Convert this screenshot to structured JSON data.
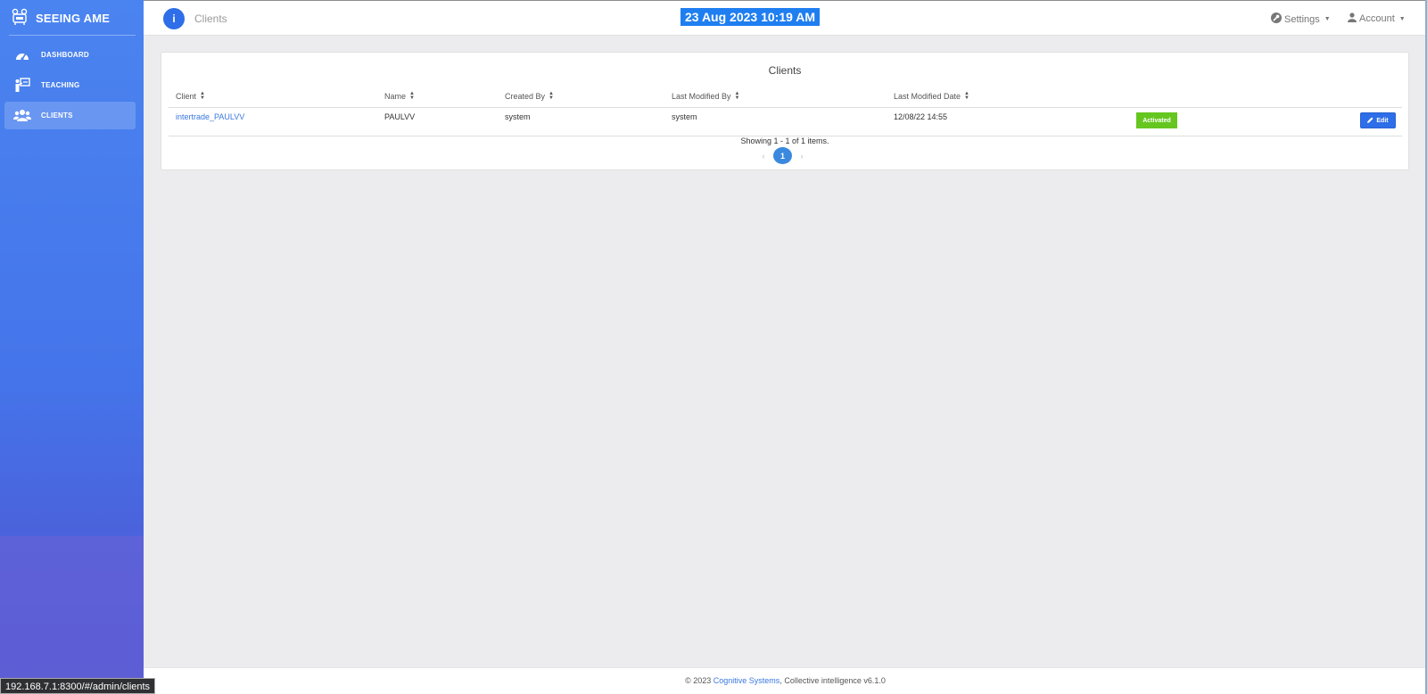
{
  "app": {
    "name": "SEEING AME"
  },
  "sidebar": {
    "items": [
      {
        "label": "DASHBOARD",
        "icon": "dashboard-gauge-icon",
        "active": false
      },
      {
        "label": "TEACHING",
        "icon": "teaching-board-icon",
        "active": false
      },
      {
        "label": "CLIENTS",
        "icon": "users-group-icon",
        "active": true
      }
    ]
  },
  "topbar": {
    "info_icon": "i",
    "crumb": "Clients",
    "datetime": "23 Aug 2023 10:19 AM",
    "settings_label": "Settings",
    "account_label": "Account"
  },
  "clients": {
    "title": "Clients",
    "headers": [
      "Client",
      "Name",
      "Created By",
      "Last Modified By",
      "Last Modified Date"
    ],
    "rows": [
      {
        "client": "intertrade_PAULVV",
        "name": "PAULVV",
        "created_by": "system",
        "last_modified_by": "system",
        "last_modified_date": "12/08/22 14:55",
        "status": "Activated",
        "edit_label": "Edit"
      }
    ],
    "showing": "Showing 1 - 1 of 1 items.",
    "pagination": {
      "prev": "‹",
      "current": "1",
      "next": "›"
    }
  },
  "footer": {
    "copyright": "© 2023",
    "company": "Cognitive Systems",
    "suffix": ", Collective intelligence v6.1.0"
  },
  "status_bar": {
    "url": "192.168.7.1:8300/#/admin/clients"
  },
  "colors": {
    "primary": "#2e6ee8",
    "sidebar_top": "#4a84f0",
    "activated": "#65c620",
    "link": "#3a78e0"
  }
}
